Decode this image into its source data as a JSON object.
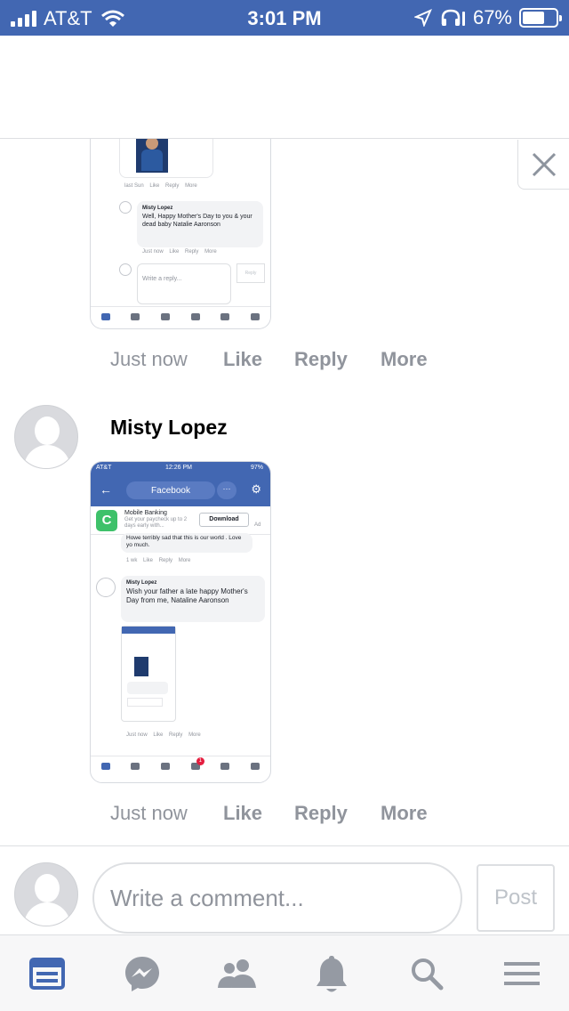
{
  "status_bar": {
    "carrier": "AT&T",
    "time": "3:01 PM",
    "battery": "67%",
    "battery_level": 0.67,
    "icons": [
      "signal-icon",
      "wifi-icon",
      "location-icon",
      "headphones-icon",
      "battery-icon"
    ]
  },
  "close_icon": "close-icon",
  "thumbnail1": {
    "meta_top": [
      "last Sun",
      "Like",
      "Reply",
      "More"
    ],
    "comment_name": "Misty Lopez",
    "comment_text": "Well, Happy Mother's Day to you & your dead baby Natalie Aaronson",
    "comment_meta": [
      "Just now",
      "Like",
      "Reply",
      "More"
    ],
    "reply_placeholder": "Write a reply...",
    "reply_button": "Reply"
  },
  "comment1": {
    "time": "Just now",
    "like": "Like",
    "reply": "Reply",
    "more": "More"
  },
  "comment2": {
    "name": "Misty Lopez",
    "time": "Just now",
    "like": "Like",
    "reply": "Reply",
    "more": "More"
  },
  "thumbnail2": {
    "carrier": "AT&T",
    "time": "12:26 PM",
    "battery": "97%",
    "header_title": "Facebook",
    "ad_title": "Mobile Banking",
    "ad_text": "Get your paycheck up to 2 days early with...",
    "ad_button": "Download",
    "ad_label": "Ad",
    "prev_comment": "Howe terribly sad that this is our world . Love yo much.",
    "prev_meta": [
      "1 wk",
      "Like",
      "Reply",
      "More"
    ],
    "comment_name": "Misty Lopez",
    "comment_text": "Wish your father a late happy Mother's Day from me, Nataline Aaronson",
    "comment_meta": [
      "Just now",
      "Like",
      "Reply",
      "More"
    ],
    "notification_count": "1"
  },
  "composer": {
    "placeholder": "Write a comment...",
    "post_label": "Post"
  },
  "tabbar": {
    "tabs": [
      "news-feed-icon",
      "messenger-icon",
      "friends-icon",
      "notifications-icon",
      "search-icon",
      "menu-icon"
    ],
    "active_color": "#4267b2",
    "inactive_color": "#959aa3"
  }
}
